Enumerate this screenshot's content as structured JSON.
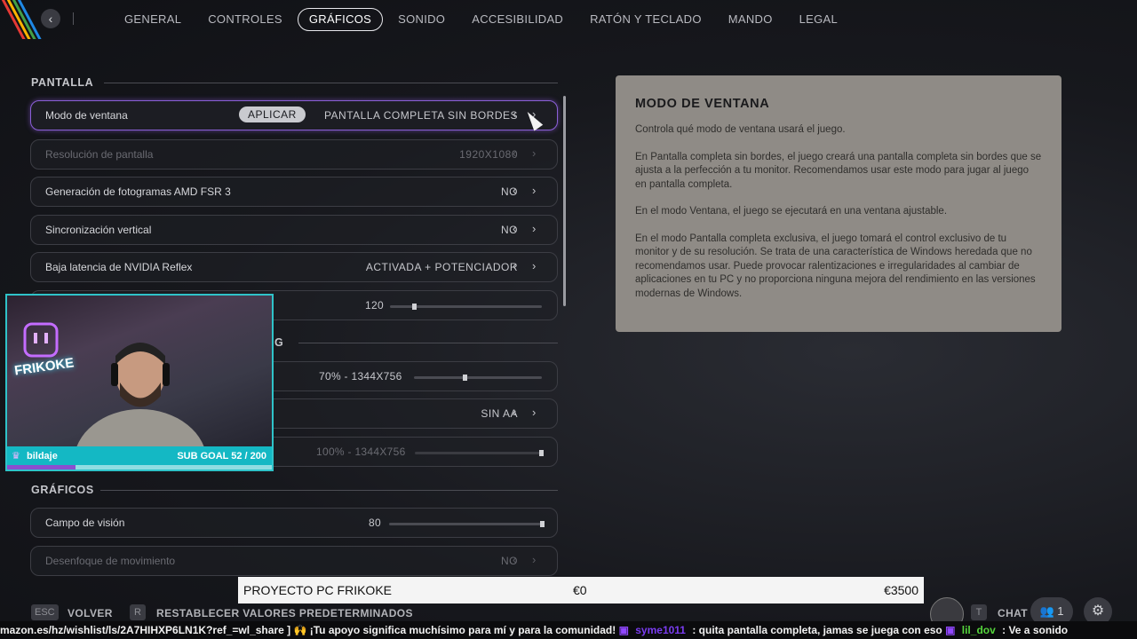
{
  "nav": {
    "tabs": [
      "GENERAL",
      "CONTROLES",
      "GRÁFICOS",
      "SONIDO",
      "ACCESIBILIDAD",
      "RATÓN Y TECLADO",
      "MANDO",
      "LEGAL"
    ],
    "active_tab": "GRÁFICOS",
    "back_icon": "chevron-left-icon"
  },
  "sections": {
    "pantalla": "PANTALLA",
    "scaling_partial": "G",
    "graficos": "GRÁFICOS"
  },
  "rows": {
    "window_mode": {
      "label": "Modo de ventana",
      "apply": "APLICAR",
      "value": "PANTALLA COMPLETA SIN BORDES"
    },
    "resolution": {
      "label": "Resolución de pantalla",
      "value": "1920X1080"
    },
    "fsr": {
      "label": "Generación de fotogramas AMD FSR 3",
      "value": "NO"
    },
    "vsync": {
      "label": "Sincronización vertical",
      "value": "NO"
    },
    "reflex": {
      "label": "Baja latencia de NVIDIA Reflex",
      "value": "ACTIVADA + POTENCIADOR"
    },
    "fps": {
      "value": "120",
      "level": 0.16
    },
    "render_scale": {
      "value": "70% - 1344X756",
      "level": 0.4
    },
    "aa": {
      "value": "SIN AA"
    },
    "sharp": {
      "value": "100% - 1344X756",
      "level": 1.0
    },
    "fov": {
      "label": "Campo de visión",
      "value": "80",
      "level": 1.0
    },
    "motion_blur": {
      "label": "Desenfoque de movimiento",
      "value": "NO"
    }
  },
  "info": {
    "title": "MODO DE VENTANA",
    "p1": "Controla qué modo de ventana usará el juego.",
    "p2": "En Pantalla completa sin bordes, el juego creará una pantalla completa sin bordes que se ajusta a la perfección a tu monitor. Recomendamos usar este modo para jugar al juego en pantalla completa.",
    "p3": "En el modo Ventana, el juego se ejecutará en una ventana ajustable.",
    "p4": "En el modo Pantalla completa exclusiva, el juego tomará el control exclusivo de tu monitor y de su resolución. Se trata de una característica de Windows heredada que no recomendamos usar. Puede provocar ralentizaciones e irregularidades al cambiar de aplicaciones en tu PC y no proporciona ninguna mejora del rendimiento en las versiones modernas de Windows."
  },
  "webcam": {
    "brand": "FRIKOKE",
    "sub_user": "bildaje",
    "sub_goal": "SUB GOAL 52 / 200",
    "progress": 0.26
  },
  "project": {
    "name": "PROYECTO PC FRIKOKE",
    "current": "€0",
    "target": "€3500"
  },
  "footer": {
    "esc_key": "ESC",
    "back": "VOLVER",
    "r_key": "R",
    "reset": "RESTABLECER VALORES PREDETERMINADOS",
    "t_key": "T",
    "chat": "CHAT",
    "friends_count": "1"
  },
  "ticker": {
    "text1": "mazon.es/hz/wishlist/ls/2A7HIHXP6LN1K?ref_=wl_share ] 🙌 ¡Tu apoyo significa muchísimo para mí y para la comunidad!",
    "user1": "syme1011",
    "text2": ": quita pantalla completa, jamas se juega con eso",
    "user2": "lil_dov",
    "text3": ": Ve a sonido"
  }
}
